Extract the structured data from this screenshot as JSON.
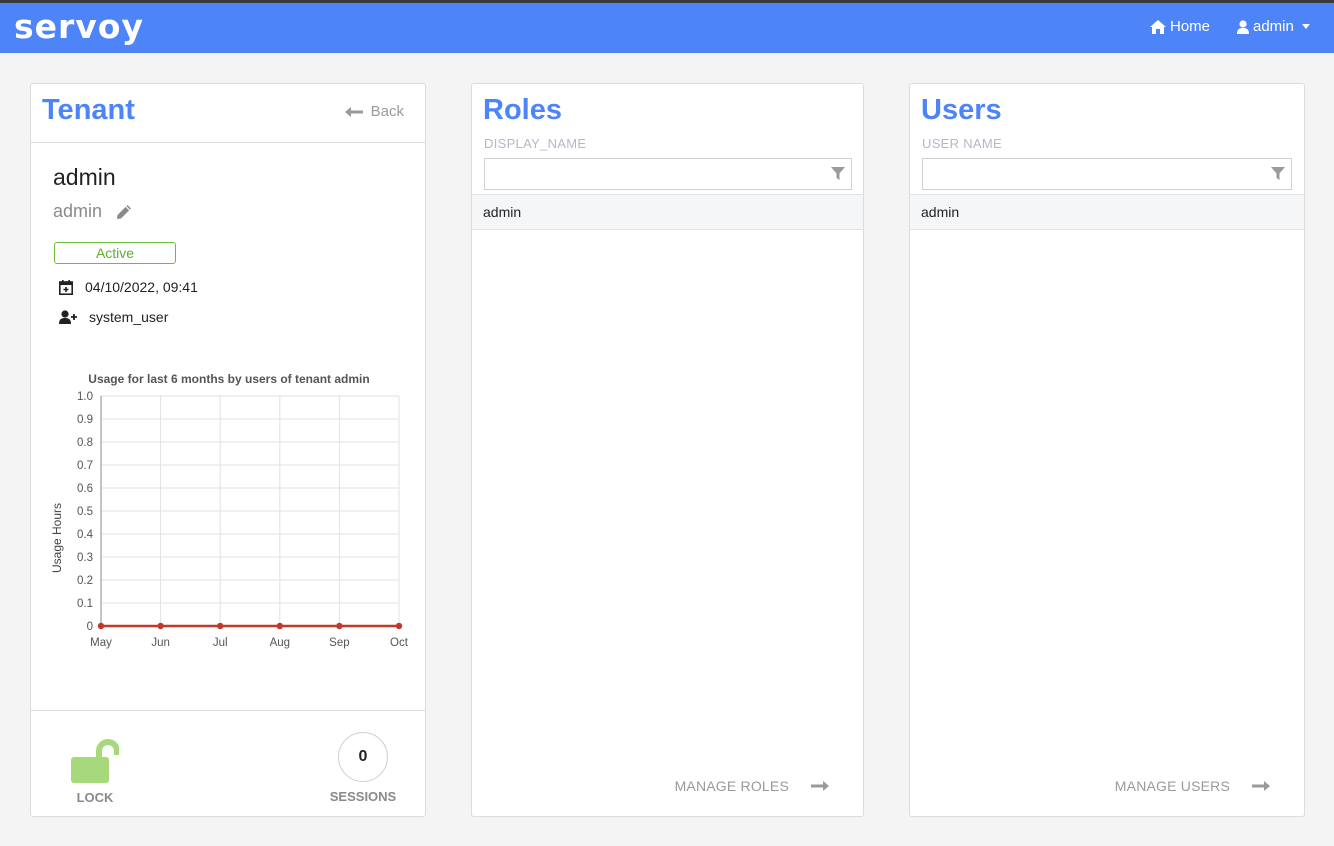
{
  "header": {
    "logo": "servoy",
    "home_label": "Home",
    "user_label": "admin"
  },
  "tenant": {
    "title": "Tenant",
    "back_label": "Back",
    "name": "admin",
    "display_name": "admin",
    "status": "Active",
    "created": "04/10/2022, 09:41",
    "created_by": "system_user",
    "lock_label": "LOCK",
    "sessions_count": "0",
    "sessions_label": "SESSIONS"
  },
  "chart_data": {
    "type": "line",
    "title": "Usage for last 6 months by users of tenant admin",
    "ylabel": "Usage Hours",
    "xlabel": "",
    "categories": [
      "May",
      "Jun",
      "Jul",
      "Aug",
      "Sep",
      "Oct"
    ],
    "series": [
      {
        "values": [
          0,
          0,
          0,
          0,
          0,
          0
        ]
      }
    ],
    "ylim": [
      0,
      1.0
    ],
    "yticks": [
      "0",
      "0.1",
      "0.2",
      "0.3",
      "0.4",
      "0.5",
      "0.6",
      "0.7",
      "0.8",
      "0.9",
      "1.0"
    ],
    "grid": true,
    "series_color": "#c0392b"
  },
  "roles": {
    "title": "Roles",
    "column": "DISPLAY_NAME",
    "filter_value": "",
    "items": [
      "admin"
    ],
    "manage_label": "MANAGE ROLES"
  },
  "users": {
    "title": "Users",
    "column": "USER NAME",
    "filter_value": "",
    "items": [
      "admin"
    ],
    "manage_label": "MANAGE USERS"
  },
  "colors": {
    "accent": "#4d84f8",
    "active": "#5fae2f",
    "lock": "#a8d87c",
    "line": "#c0392b"
  }
}
